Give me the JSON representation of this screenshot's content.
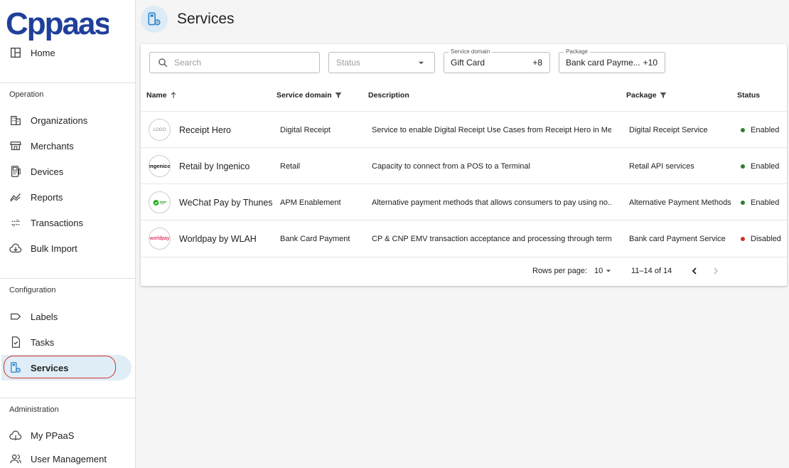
{
  "brand": {
    "logo_text": "Cppaas",
    "color": "#1f3f9a"
  },
  "sidebar": {
    "home": "Home",
    "sections": {
      "operation": "Operation",
      "configuration": "Configuration",
      "administration": "Administration"
    },
    "operation_items": [
      {
        "label": "Organizations",
        "icon": "building-icon"
      },
      {
        "label": "Merchants",
        "icon": "store-icon"
      },
      {
        "label": "Devices",
        "icon": "pos-terminal-icon"
      },
      {
        "label": "Reports",
        "icon": "chart-line-icon"
      },
      {
        "label": "Transactions",
        "icon": "swap-arrows-icon"
      },
      {
        "label": "Bulk Import",
        "icon": "cloud-download-icon"
      }
    ],
    "configuration_items": [
      {
        "label": "Labels",
        "icon": "label-icon"
      },
      {
        "label": "Tasks",
        "icon": "task-icon"
      },
      {
        "label": "Services",
        "icon": "services-icon",
        "active": true
      }
    ],
    "administration_items": [
      {
        "label": "My PPaaS",
        "icon": "cloud-icon"
      },
      {
        "label": "User Management",
        "icon": "users-icon"
      }
    ]
  },
  "header": {
    "title": "Services"
  },
  "filters": {
    "search_placeholder": "Search",
    "status_placeholder": "Status",
    "service_domain": {
      "legend": "Service domain",
      "value": "Gift Card",
      "more": "+8"
    },
    "package": {
      "legend": "Package",
      "value": "Bank card Payme...",
      "more": "+10"
    }
  },
  "table": {
    "columns": {
      "name": "Name",
      "service_domain": "Service domain",
      "description": "Description",
      "package": "Package",
      "status": "Status"
    },
    "rows": [
      {
        "logo": "LOGO",
        "name": "Receipt Hero",
        "domain": "Digital Receipt",
        "description": "Service to enable Digital Receipt Use Cases from Receipt Hero in Mer...",
        "package": "Digital Receipt Service",
        "status": "Enabled"
      },
      {
        "logo": "ingenico",
        "name": "Retail by Ingenico",
        "domain": "Retail",
        "description": "Capacity to connect from a POS to a Terminal",
        "package": "Retail API services",
        "status": "Enabled"
      },
      {
        "logo": "",
        "name": "WeChat Pay by Thunes",
        "domain": "APM Enablement",
        "description": "Alternative payment methods that allows consumers to pay using no...",
        "package": "Alternative Payment Methods",
        "status": "Enabled"
      },
      {
        "logo": "worldpay",
        "name": "Worldpay by WLAH",
        "domain": "Bank Card Payment",
        "description": "CP & CNP EMV transaction acceptance and processing through termi...",
        "package": "Bank card Payment Service",
        "status": "Disabled"
      }
    ]
  },
  "pagination": {
    "rows_per_page_label": "Rows per page:",
    "rows_per_page": "10",
    "range": "11–14 of 14"
  },
  "colors": {
    "enabled": "#2e7d32",
    "disabled": "#d32f2f",
    "active_bg": "#dfeef6",
    "accent": "#1f3f9a"
  }
}
